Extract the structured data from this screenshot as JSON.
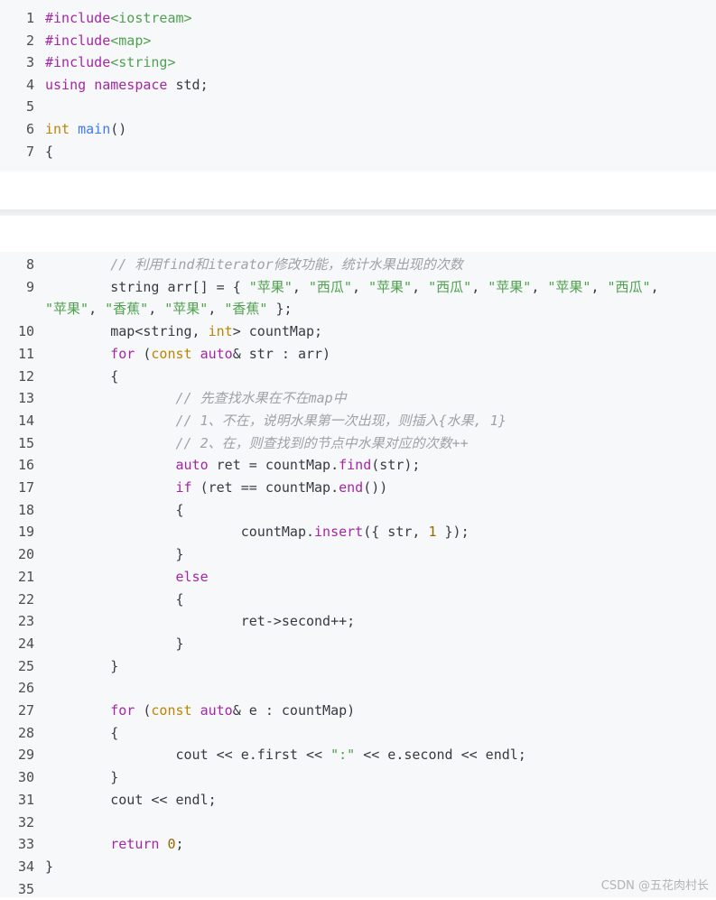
{
  "colors": {
    "background": "#f6f8fa",
    "line_number": "#4d4d4d",
    "keyword": "#a626a4",
    "string": "#50a14f",
    "type": "#c18401",
    "function": "#4078f2",
    "comment": "#a0a1a7",
    "number": "#986801"
  },
  "block1": {
    "lines": [
      {
        "n": "1",
        "tokens": [
          {
            "c": "pp",
            "t": "#include"
          },
          {
            "c": "inc",
            "t": "<iostream>"
          }
        ]
      },
      {
        "n": "2",
        "tokens": [
          {
            "c": "pp",
            "t": "#include"
          },
          {
            "c": "inc",
            "t": "<map>"
          }
        ]
      },
      {
        "n": "3",
        "tokens": [
          {
            "c": "pp",
            "t": "#include"
          },
          {
            "c": "inc",
            "t": "<string>"
          }
        ]
      },
      {
        "n": "4",
        "tokens": [
          {
            "c": "kw",
            "t": "using"
          },
          {
            "c": "pl",
            "t": " "
          },
          {
            "c": "kw",
            "t": "namespace"
          },
          {
            "c": "pl",
            "t": " std;"
          }
        ]
      },
      {
        "n": "5",
        "tokens": []
      },
      {
        "n": "6",
        "tokens": [
          {
            "c": "ty",
            "t": "int"
          },
          {
            "c": "pl",
            "t": " "
          },
          {
            "c": "fn",
            "t": "main"
          },
          {
            "c": "pl",
            "t": "()"
          }
        ]
      },
      {
        "n": "7",
        "tokens": [
          {
            "c": "pl",
            "t": "{"
          }
        ]
      }
    ]
  },
  "block2": {
    "lines": [
      {
        "n": "8",
        "tokens": [
          {
            "c": "pl",
            "t": "        "
          },
          {
            "c": "cm",
            "t": "// 利用find和iterator修改功能，统计水果出现的次数"
          }
        ]
      },
      {
        "n": "9",
        "tokens": [
          {
            "c": "pl",
            "t": "        string arr[] = { "
          },
          {
            "c": "str",
            "t": "\"苹果\""
          },
          {
            "c": "pl",
            "t": ", "
          },
          {
            "c": "str",
            "t": "\"西瓜\""
          },
          {
            "c": "pl",
            "t": ", "
          },
          {
            "c": "str",
            "t": "\"苹果\""
          },
          {
            "c": "pl",
            "t": ", "
          },
          {
            "c": "str",
            "t": "\"西瓜\""
          },
          {
            "c": "pl",
            "t": ", "
          },
          {
            "c": "str",
            "t": "\"苹果\""
          },
          {
            "c": "pl",
            "t": ", "
          },
          {
            "c": "str",
            "t": "\"苹果\""
          },
          {
            "c": "pl",
            "t": ", "
          },
          {
            "c": "str",
            "t": "\"西瓜\""
          },
          {
            "c": "pl",
            "t": ","
          }
        ]
      },
      {
        "n": "",
        "tokens": [
          {
            "c": "str",
            "t": "\"苹果\""
          },
          {
            "c": "pl",
            "t": ", "
          },
          {
            "c": "str",
            "t": "\"香蕉\""
          },
          {
            "c": "pl",
            "t": ", "
          },
          {
            "c": "str",
            "t": "\"苹果\""
          },
          {
            "c": "pl",
            "t": ", "
          },
          {
            "c": "str",
            "t": "\"香蕉\""
          },
          {
            "c": "pl",
            "t": " };"
          }
        ]
      },
      {
        "n": "10",
        "tokens": [
          {
            "c": "pl",
            "t": "        map<string, "
          },
          {
            "c": "ty",
            "t": "int"
          },
          {
            "c": "pl",
            "t": "> countMap;"
          }
        ]
      },
      {
        "n": "11",
        "tokens": [
          {
            "c": "pl",
            "t": "        "
          },
          {
            "c": "kw",
            "t": "for"
          },
          {
            "c": "pl",
            "t": " ("
          },
          {
            "c": "ty",
            "t": "const"
          },
          {
            "c": "pl",
            "t": " "
          },
          {
            "c": "kw",
            "t": "auto"
          },
          {
            "c": "pl",
            "t": "& str : arr)"
          }
        ]
      },
      {
        "n": "12",
        "tokens": [
          {
            "c": "pl",
            "t": "        {"
          }
        ]
      },
      {
        "n": "13",
        "tokens": [
          {
            "c": "pl",
            "t": "                "
          },
          {
            "c": "cm",
            "t": "// 先查找水果在不在map中"
          }
        ]
      },
      {
        "n": "14",
        "tokens": [
          {
            "c": "pl",
            "t": "                "
          },
          {
            "c": "cm",
            "t": "// 1、不在，说明水果第一次出现，则插入{水果, 1}"
          }
        ]
      },
      {
        "n": "15",
        "tokens": [
          {
            "c": "pl",
            "t": "                "
          },
          {
            "c": "cm",
            "t": "// 2、在，则查找到的节点中水果对应的次数++"
          }
        ]
      },
      {
        "n": "16",
        "tokens": [
          {
            "c": "pl",
            "t": "                "
          },
          {
            "c": "kw",
            "t": "auto"
          },
          {
            "c": "pl",
            "t": " ret = countMap."
          },
          {
            "c": "kw",
            "t": "find"
          },
          {
            "c": "pl",
            "t": "(str);"
          }
        ]
      },
      {
        "n": "17",
        "tokens": [
          {
            "c": "pl",
            "t": "                "
          },
          {
            "c": "kw",
            "t": "if"
          },
          {
            "c": "pl",
            "t": " (ret == countMap."
          },
          {
            "c": "kw",
            "t": "end"
          },
          {
            "c": "pl",
            "t": "())"
          }
        ]
      },
      {
        "n": "18",
        "tokens": [
          {
            "c": "pl",
            "t": "                {"
          }
        ]
      },
      {
        "n": "19",
        "tokens": [
          {
            "c": "pl",
            "t": "                        countMap."
          },
          {
            "c": "kw",
            "t": "insert"
          },
          {
            "c": "pl",
            "t": "({ str, "
          },
          {
            "c": "num",
            "t": "1"
          },
          {
            "c": "pl",
            "t": " });"
          }
        ]
      },
      {
        "n": "20",
        "tokens": [
          {
            "c": "pl",
            "t": "                }"
          }
        ]
      },
      {
        "n": "21",
        "tokens": [
          {
            "c": "pl",
            "t": "                "
          },
          {
            "c": "kw",
            "t": "else"
          }
        ]
      },
      {
        "n": "22",
        "tokens": [
          {
            "c": "pl",
            "t": "                {"
          }
        ]
      },
      {
        "n": "23",
        "tokens": [
          {
            "c": "pl",
            "t": "                        ret->second++;"
          }
        ]
      },
      {
        "n": "24",
        "tokens": [
          {
            "c": "pl",
            "t": "                }"
          }
        ]
      },
      {
        "n": "25",
        "tokens": [
          {
            "c": "pl",
            "t": "        }"
          }
        ]
      },
      {
        "n": "26",
        "tokens": []
      },
      {
        "n": "27",
        "tokens": [
          {
            "c": "pl",
            "t": "        "
          },
          {
            "c": "kw",
            "t": "for"
          },
          {
            "c": "pl",
            "t": " ("
          },
          {
            "c": "ty",
            "t": "const"
          },
          {
            "c": "pl",
            "t": " "
          },
          {
            "c": "kw",
            "t": "auto"
          },
          {
            "c": "pl",
            "t": "& e : countMap)"
          }
        ]
      },
      {
        "n": "28",
        "tokens": [
          {
            "c": "pl",
            "t": "        {"
          }
        ]
      },
      {
        "n": "29",
        "tokens": [
          {
            "c": "pl",
            "t": "                cout << e.first << "
          },
          {
            "c": "str",
            "t": "\":\""
          },
          {
            "c": "pl",
            "t": " << e.second << endl;"
          }
        ]
      },
      {
        "n": "30",
        "tokens": [
          {
            "c": "pl",
            "t": "        }"
          }
        ]
      },
      {
        "n": "31",
        "tokens": [
          {
            "c": "pl",
            "t": "        cout << endl;"
          }
        ]
      },
      {
        "n": "32",
        "tokens": []
      },
      {
        "n": "33",
        "tokens": [
          {
            "c": "pl",
            "t": "        "
          },
          {
            "c": "kw",
            "t": "return"
          },
          {
            "c": "pl",
            "t": " "
          },
          {
            "c": "num",
            "t": "0"
          },
          {
            "c": "pl",
            "t": ";"
          }
        ]
      },
      {
        "n": "34",
        "tokens": [
          {
            "c": "pl",
            "t": "}"
          }
        ]
      },
      {
        "n": "35",
        "tokens": []
      }
    ]
  },
  "watermark": "CSDN @五花肉村长"
}
